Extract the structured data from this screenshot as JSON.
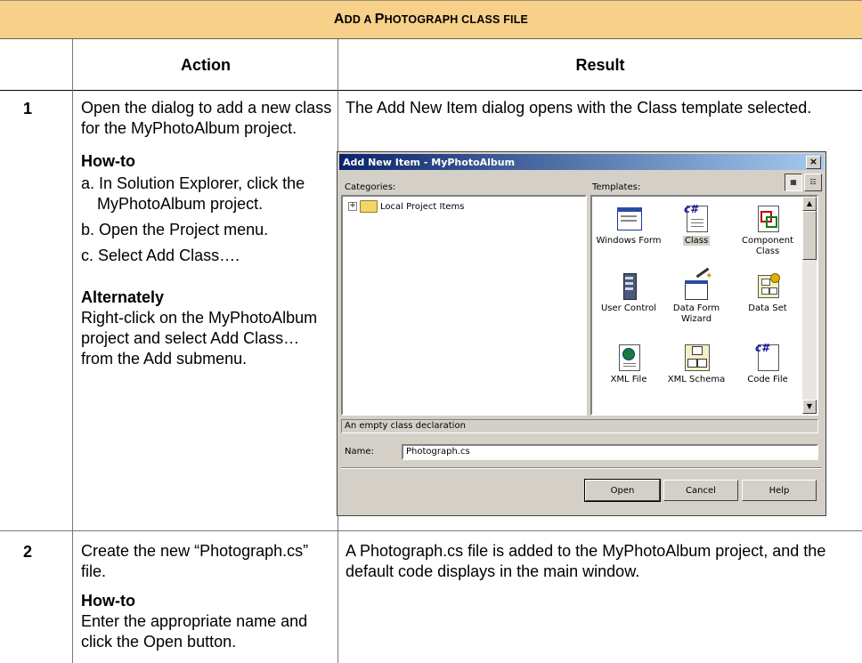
{
  "title": {
    "first": "A",
    "first_rest": "DD A ",
    "second": "P",
    "second_rest": "HOTOGRAPH CLASS FILE"
  },
  "headers": {
    "action": "Action",
    "result": "Result"
  },
  "step1": {
    "number": "1",
    "action": "Open the dialog to add a new class for the MyPhotoAlbum project.",
    "howto_label": "How-to",
    "howto_items": [
      "a. In Solution Explorer, click the MyPhotoAlbum project.",
      "b. Open the Project menu.",
      "c. Select Add Class…."
    ],
    "alternately_label": "Alternately",
    "alternately_text": "Right-click on the MyPhotoAlbum project and select Add Class… from the Add submenu.",
    "result": "The Add New Item dialog opens with the Class template selected."
  },
  "dialog": {
    "title": "Add New Item - MyPhotoAlbum",
    "close": "×",
    "categories_label": "Categories:",
    "templates_label": "Templates:",
    "tree_item": "Local Project Items",
    "templates": [
      {
        "label": "Windows Form",
        "icon": "windows-form-icon"
      },
      {
        "label": "Class",
        "icon": "class-file-icon",
        "selected": true
      },
      {
        "label": "Component Class",
        "icon": "component-class-icon"
      },
      {
        "label": "User Control",
        "icon": "user-control-icon"
      },
      {
        "label": "Data Form Wizard",
        "icon": "data-form-wizard-icon"
      },
      {
        "label": "Data Set",
        "icon": "data-set-icon"
      },
      {
        "label": "XML File",
        "icon": "xml-file-icon"
      },
      {
        "label": "XML Schema",
        "icon": "xml-schema-icon"
      },
      {
        "label": "Code File",
        "icon": "code-file-icon"
      }
    ],
    "description": "An empty class declaration",
    "name_label": "Name:",
    "name_value": "Photograph.cs",
    "buttons": {
      "open": "Open",
      "cancel": "Cancel",
      "help": "Help"
    }
  },
  "step2": {
    "number": "2",
    "action": "Create the new “Photograph.cs” file.",
    "howto_label": "How-to",
    "howto_text": "Enter the appropriate name and click the Open button.",
    "result": "A Photograph.cs file is added to the MyPhotoAlbum project, and the default code displays in the main window."
  }
}
